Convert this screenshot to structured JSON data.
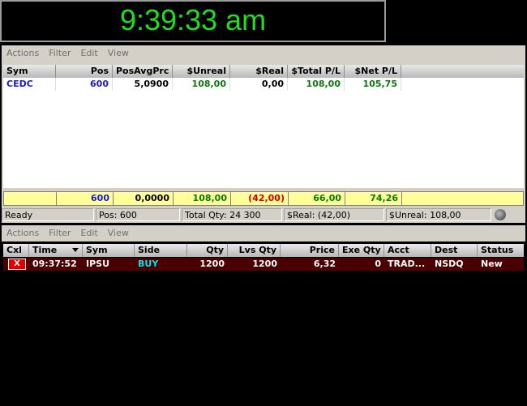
{
  "clock": {
    "time": "9:39:33 am"
  },
  "positions": {
    "menu": [
      "Actions",
      "Filter",
      "Edit",
      "View"
    ],
    "columns": [
      "Sym",
      "Pos",
      "PosAvgPrc",
      "$Unreal",
      "$Real",
      "$Total P/L",
      "$Net P/L"
    ],
    "rows": [
      {
        "sym": "CEDC",
        "pos": "600",
        "avg": "5,0900",
        "unreal": "108,00",
        "real": "0,00",
        "total": "108,00",
        "net": "105,75"
      }
    ],
    "totals": {
      "pos": "600",
      "avg": "0,0000",
      "unreal": "108,00",
      "real": "(42,00)",
      "total": "66,00",
      "net": "74,26"
    },
    "status": {
      "ready": "Ready",
      "pos": "Pos: 600",
      "total_qty": "Total Qty: 24 300",
      "real": "$Real: (42,00)",
      "unreal": "$Unreal: 108,00"
    }
  },
  "orders": {
    "menu": [
      "Actions",
      "Filter",
      "Edit",
      "View"
    ],
    "columns": [
      "Cxl",
      "Time",
      "Sym",
      "Side",
      "Qty",
      "Lvs Qty",
      "Price",
      "Exe Qty",
      "Acct",
      "Dest",
      "Status"
    ],
    "rows": [
      {
        "cxl": "X",
        "time": "09:37:52",
        "sym": "IPSU",
        "side": "BUY",
        "qty": "1200",
        "lvs": "1200",
        "price": "6,32",
        "exe": "0",
        "acct": "TRAD...",
        "dest": "NSDQ",
        "status": "New"
      }
    ]
  },
  "colors": {
    "clock": "#22dd22",
    "order_row_bg": "#4a0000",
    "totals_bg": "#ffff99",
    "buy": "#00e5ee"
  },
  "icons": [
    "sort-down-icon",
    "status-light-icon",
    "cancel-x-icon"
  ]
}
